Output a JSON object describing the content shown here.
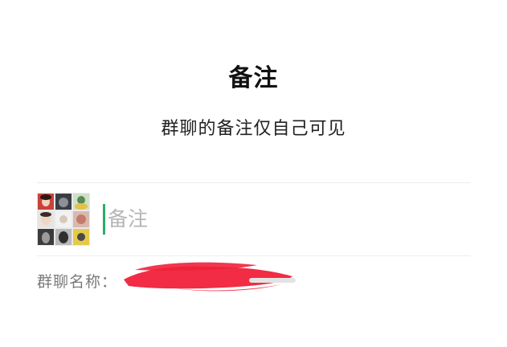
{
  "dialog": {
    "title": "备注",
    "subtitle": "群聊的备注仅自己可见"
  },
  "remark": {
    "placeholder": "备注",
    "value": ""
  },
  "group_name": {
    "label": "群聊名称："
  },
  "colors": {
    "caret": "#2aae67",
    "redaction": "#f0213a"
  },
  "icons": {
    "group_avatar": "group-avatar-grid-icon"
  }
}
